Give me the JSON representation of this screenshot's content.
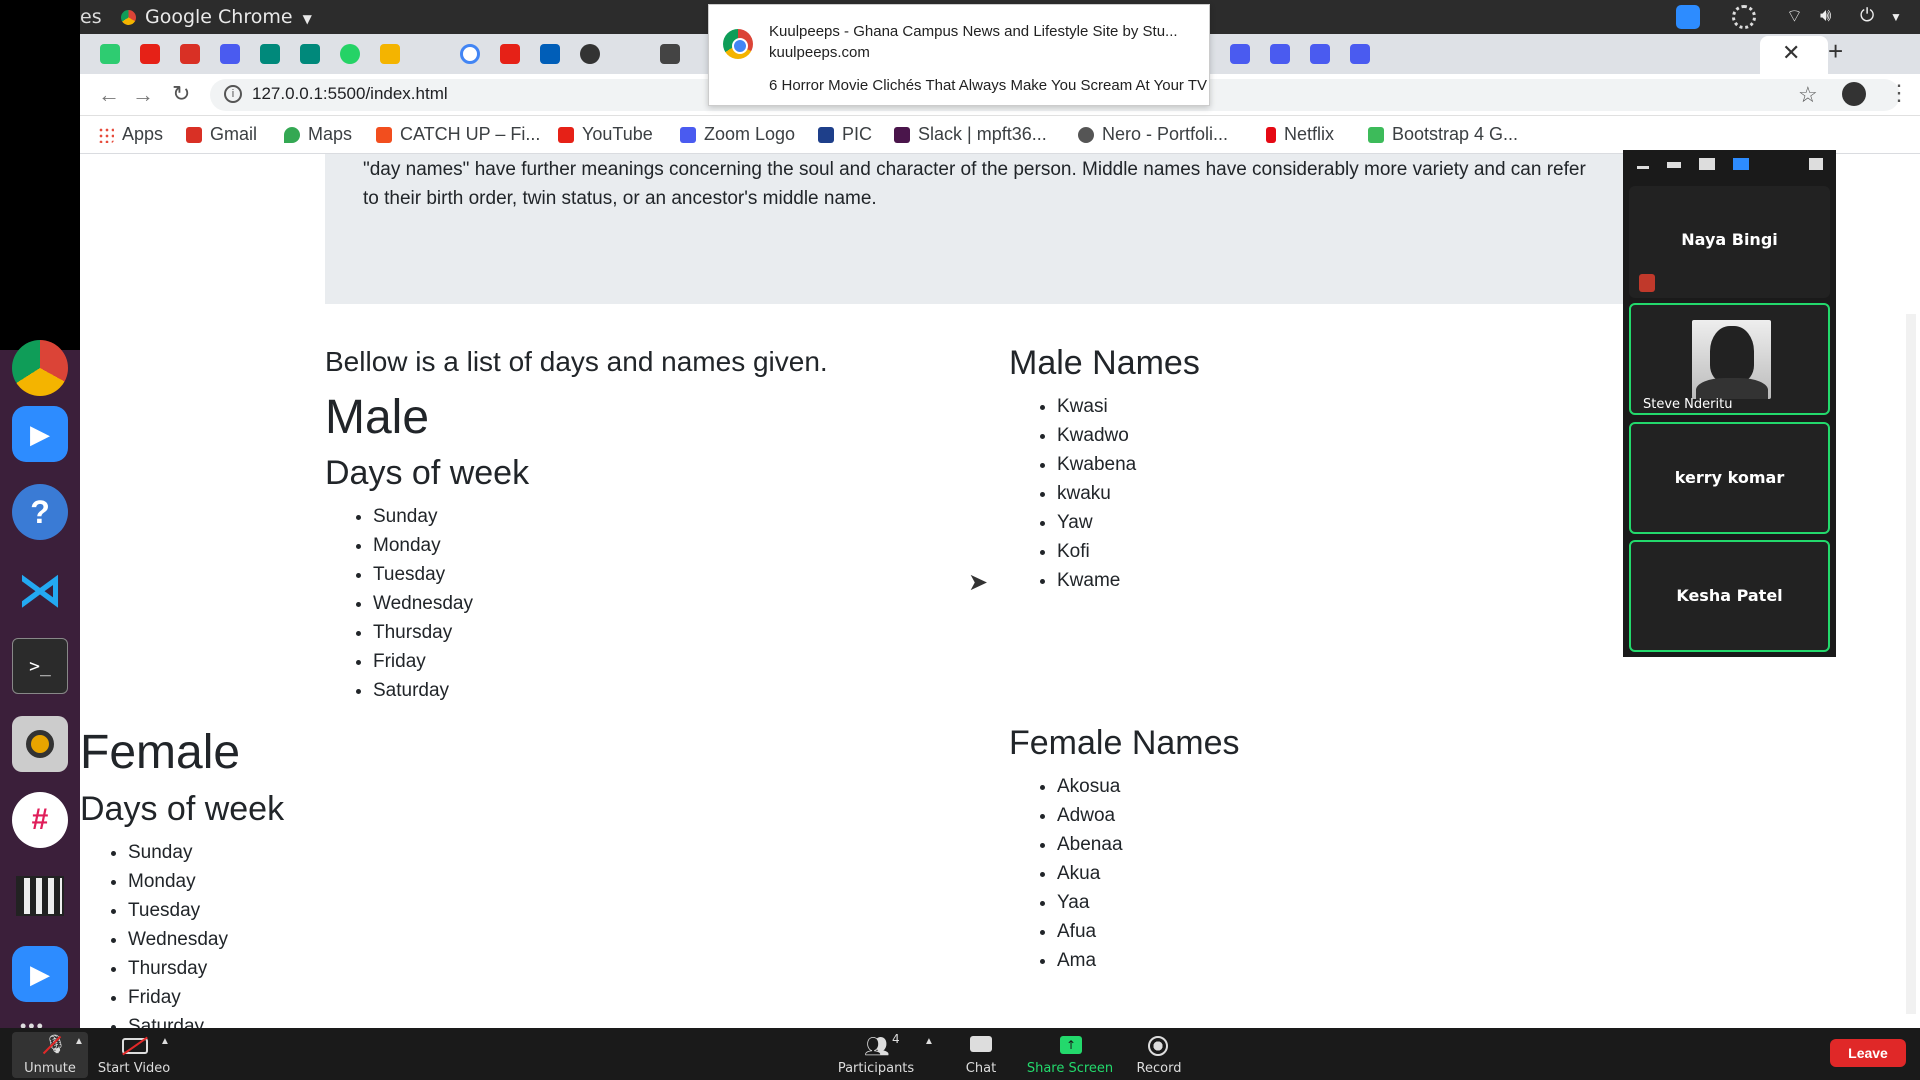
{
  "topbar": {
    "partial_title": "es",
    "app_name": "Google Chrome"
  },
  "notification": {
    "title": "Kuulpeeps - Ghana Campus News and Lifestyle Site by Stu...",
    "site": "kuulpeeps.com",
    "body": "6 Horror Movie Clichés That Always Make You Scream At Your TV"
  },
  "browser": {
    "url": "127.0.0.1:5500/index.html",
    "bookmarks": [
      "Apps",
      "Gmail",
      "Maps",
      "CATCH UP – Fi...",
      "YouTube",
      "Zoom Logo",
      "PIC",
      "Slack | mpft36...",
      "Nero - Portfoli...",
      "Netflix",
      "Bootstrap 4 G..."
    ]
  },
  "page": {
    "intro_line1": "\"day names\" have further meanings concerning the soul and character of the person. Middle names have considerably more variety and can refer",
    "intro_line2": "to their birth order, twin status, or an ancestor's middle name.",
    "list_intro": "Bellow is a list of days and names given.",
    "male_heading": "Male",
    "days_heading": "Days of week",
    "male_days": [
      "Sunday",
      "Monday",
      "Tuesday",
      "Wednesday",
      "Thursday",
      "Friday",
      "Saturday"
    ],
    "male_names_heading": "Male Names",
    "male_names": [
      "Kwasi",
      "Kwadwo",
      "Kwabena",
      "kwaku",
      "Yaw",
      "Kofi",
      "Kwame"
    ],
    "female_heading": "Female",
    "female_days_heading": "Days of week",
    "female_days": [
      "Sunday",
      "Monday",
      "Tuesday",
      "Wednesday",
      "Thursday",
      "Friday",
      "Saturday"
    ],
    "female_names_heading": "Female Names",
    "female_names": [
      "Akosua",
      "Adwoa",
      "Abenaa",
      "Akua",
      "Yaa",
      "Afua",
      "Ama"
    ]
  },
  "zoom": {
    "participants_tiles": [
      "Naya Bingi",
      "Steve Nderitu",
      "kerry komar",
      "Kesha Patel"
    ],
    "toolbar": {
      "unmute": "Unmute",
      "start_video": "Start Video",
      "participants": "Participants",
      "participants_count": "4",
      "chat": "Chat",
      "share_screen": "Share Screen",
      "record": "Record",
      "leave": "Leave"
    }
  },
  "colors": {
    "share_green": "#23d96c",
    "leave_red": "#e02828",
    "dock_purple": "#3b1f3a",
    "jumbotron_gray": "#e9ecef"
  }
}
